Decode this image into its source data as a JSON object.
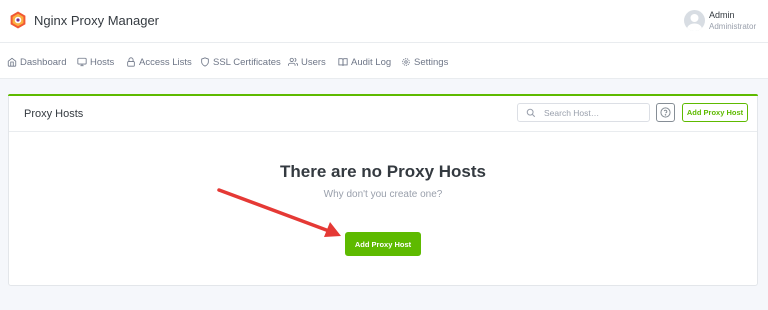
{
  "header": {
    "app_title": "Nginx Proxy Manager",
    "user": {
      "name": "Admin",
      "role": "Administrator"
    }
  },
  "nav": {
    "items": [
      {
        "label": "Dashboard",
        "icon": "home-icon"
      },
      {
        "label": "Hosts",
        "icon": "monitor-icon"
      },
      {
        "label": "Access Lists",
        "icon": "lock-icon"
      },
      {
        "label": "SSL Certificates",
        "icon": "shield-icon"
      },
      {
        "label": "Users",
        "icon": "users-icon"
      },
      {
        "label": "Audit Log",
        "icon": "book-icon"
      },
      {
        "label": "Settings",
        "icon": "gear-icon"
      }
    ]
  },
  "card": {
    "title": "Proxy Hosts",
    "search_placeholder": "Search Host…",
    "help_icon": "help-circle-icon",
    "add_button_label": "Add Proxy Host"
  },
  "empty_state": {
    "title": "There are no Proxy Hosts",
    "subtitle": "Why don't you create one?",
    "button_label": "Add Proxy Host"
  },
  "colors": {
    "accent": "#5eba00",
    "annotation_arrow": "#e53935",
    "page_bg": "#f5f7fb"
  }
}
